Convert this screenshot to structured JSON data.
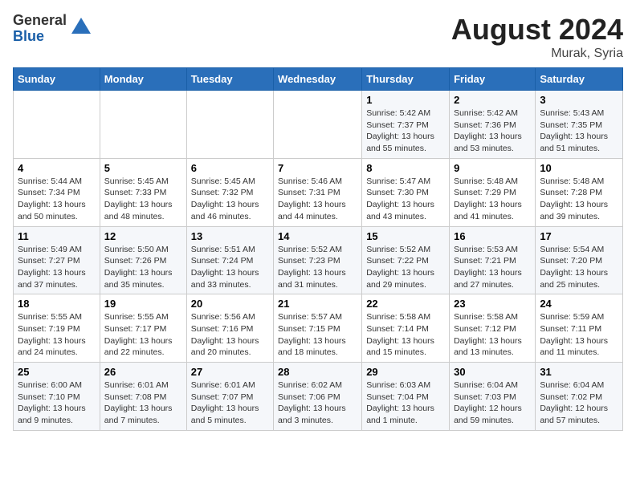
{
  "header": {
    "logo_general": "General",
    "logo_blue": "Blue",
    "month_year": "August 2024",
    "location": "Murak, Syria"
  },
  "weekdays": [
    "Sunday",
    "Monday",
    "Tuesday",
    "Wednesday",
    "Thursday",
    "Friday",
    "Saturday"
  ],
  "weeks": [
    [
      {
        "num": "",
        "info": ""
      },
      {
        "num": "",
        "info": ""
      },
      {
        "num": "",
        "info": ""
      },
      {
        "num": "",
        "info": ""
      },
      {
        "num": "1",
        "info": "Sunrise: 5:42 AM\nSunset: 7:37 PM\nDaylight: 13 hours\nand 55 minutes."
      },
      {
        "num": "2",
        "info": "Sunrise: 5:42 AM\nSunset: 7:36 PM\nDaylight: 13 hours\nand 53 minutes."
      },
      {
        "num": "3",
        "info": "Sunrise: 5:43 AM\nSunset: 7:35 PM\nDaylight: 13 hours\nand 51 minutes."
      }
    ],
    [
      {
        "num": "4",
        "info": "Sunrise: 5:44 AM\nSunset: 7:34 PM\nDaylight: 13 hours\nand 50 minutes."
      },
      {
        "num": "5",
        "info": "Sunrise: 5:45 AM\nSunset: 7:33 PM\nDaylight: 13 hours\nand 48 minutes."
      },
      {
        "num": "6",
        "info": "Sunrise: 5:45 AM\nSunset: 7:32 PM\nDaylight: 13 hours\nand 46 minutes."
      },
      {
        "num": "7",
        "info": "Sunrise: 5:46 AM\nSunset: 7:31 PM\nDaylight: 13 hours\nand 44 minutes."
      },
      {
        "num": "8",
        "info": "Sunrise: 5:47 AM\nSunset: 7:30 PM\nDaylight: 13 hours\nand 43 minutes."
      },
      {
        "num": "9",
        "info": "Sunrise: 5:48 AM\nSunset: 7:29 PM\nDaylight: 13 hours\nand 41 minutes."
      },
      {
        "num": "10",
        "info": "Sunrise: 5:48 AM\nSunset: 7:28 PM\nDaylight: 13 hours\nand 39 minutes."
      }
    ],
    [
      {
        "num": "11",
        "info": "Sunrise: 5:49 AM\nSunset: 7:27 PM\nDaylight: 13 hours\nand 37 minutes."
      },
      {
        "num": "12",
        "info": "Sunrise: 5:50 AM\nSunset: 7:26 PM\nDaylight: 13 hours\nand 35 minutes."
      },
      {
        "num": "13",
        "info": "Sunrise: 5:51 AM\nSunset: 7:24 PM\nDaylight: 13 hours\nand 33 minutes."
      },
      {
        "num": "14",
        "info": "Sunrise: 5:52 AM\nSunset: 7:23 PM\nDaylight: 13 hours\nand 31 minutes."
      },
      {
        "num": "15",
        "info": "Sunrise: 5:52 AM\nSunset: 7:22 PM\nDaylight: 13 hours\nand 29 minutes."
      },
      {
        "num": "16",
        "info": "Sunrise: 5:53 AM\nSunset: 7:21 PM\nDaylight: 13 hours\nand 27 minutes."
      },
      {
        "num": "17",
        "info": "Sunrise: 5:54 AM\nSunset: 7:20 PM\nDaylight: 13 hours\nand 25 minutes."
      }
    ],
    [
      {
        "num": "18",
        "info": "Sunrise: 5:55 AM\nSunset: 7:19 PM\nDaylight: 13 hours\nand 24 minutes."
      },
      {
        "num": "19",
        "info": "Sunrise: 5:55 AM\nSunset: 7:17 PM\nDaylight: 13 hours\nand 22 minutes."
      },
      {
        "num": "20",
        "info": "Sunrise: 5:56 AM\nSunset: 7:16 PM\nDaylight: 13 hours\nand 20 minutes."
      },
      {
        "num": "21",
        "info": "Sunrise: 5:57 AM\nSunset: 7:15 PM\nDaylight: 13 hours\nand 18 minutes."
      },
      {
        "num": "22",
        "info": "Sunrise: 5:58 AM\nSunset: 7:14 PM\nDaylight: 13 hours\nand 15 minutes."
      },
      {
        "num": "23",
        "info": "Sunrise: 5:58 AM\nSunset: 7:12 PM\nDaylight: 13 hours\nand 13 minutes."
      },
      {
        "num": "24",
        "info": "Sunrise: 5:59 AM\nSunset: 7:11 PM\nDaylight: 13 hours\nand 11 minutes."
      }
    ],
    [
      {
        "num": "25",
        "info": "Sunrise: 6:00 AM\nSunset: 7:10 PM\nDaylight: 13 hours\nand 9 minutes."
      },
      {
        "num": "26",
        "info": "Sunrise: 6:01 AM\nSunset: 7:08 PM\nDaylight: 13 hours\nand 7 minutes."
      },
      {
        "num": "27",
        "info": "Sunrise: 6:01 AM\nSunset: 7:07 PM\nDaylight: 13 hours\nand 5 minutes."
      },
      {
        "num": "28",
        "info": "Sunrise: 6:02 AM\nSunset: 7:06 PM\nDaylight: 13 hours\nand 3 minutes."
      },
      {
        "num": "29",
        "info": "Sunrise: 6:03 AM\nSunset: 7:04 PM\nDaylight: 13 hours\nand 1 minute."
      },
      {
        "num": "30",
        "info": "Sunrise: 6:04 AM\nSunset: 7:03 PM\nDaylight: 12 hours\nand 59 minutes."
      },
      {
        "num": "31",
        "info": "Sunrise: 6:04 AM\nSunset: 7:02 PM\nDaylight: 12 hours\nand 57 minutes."
      }
    ]
  ]
}
